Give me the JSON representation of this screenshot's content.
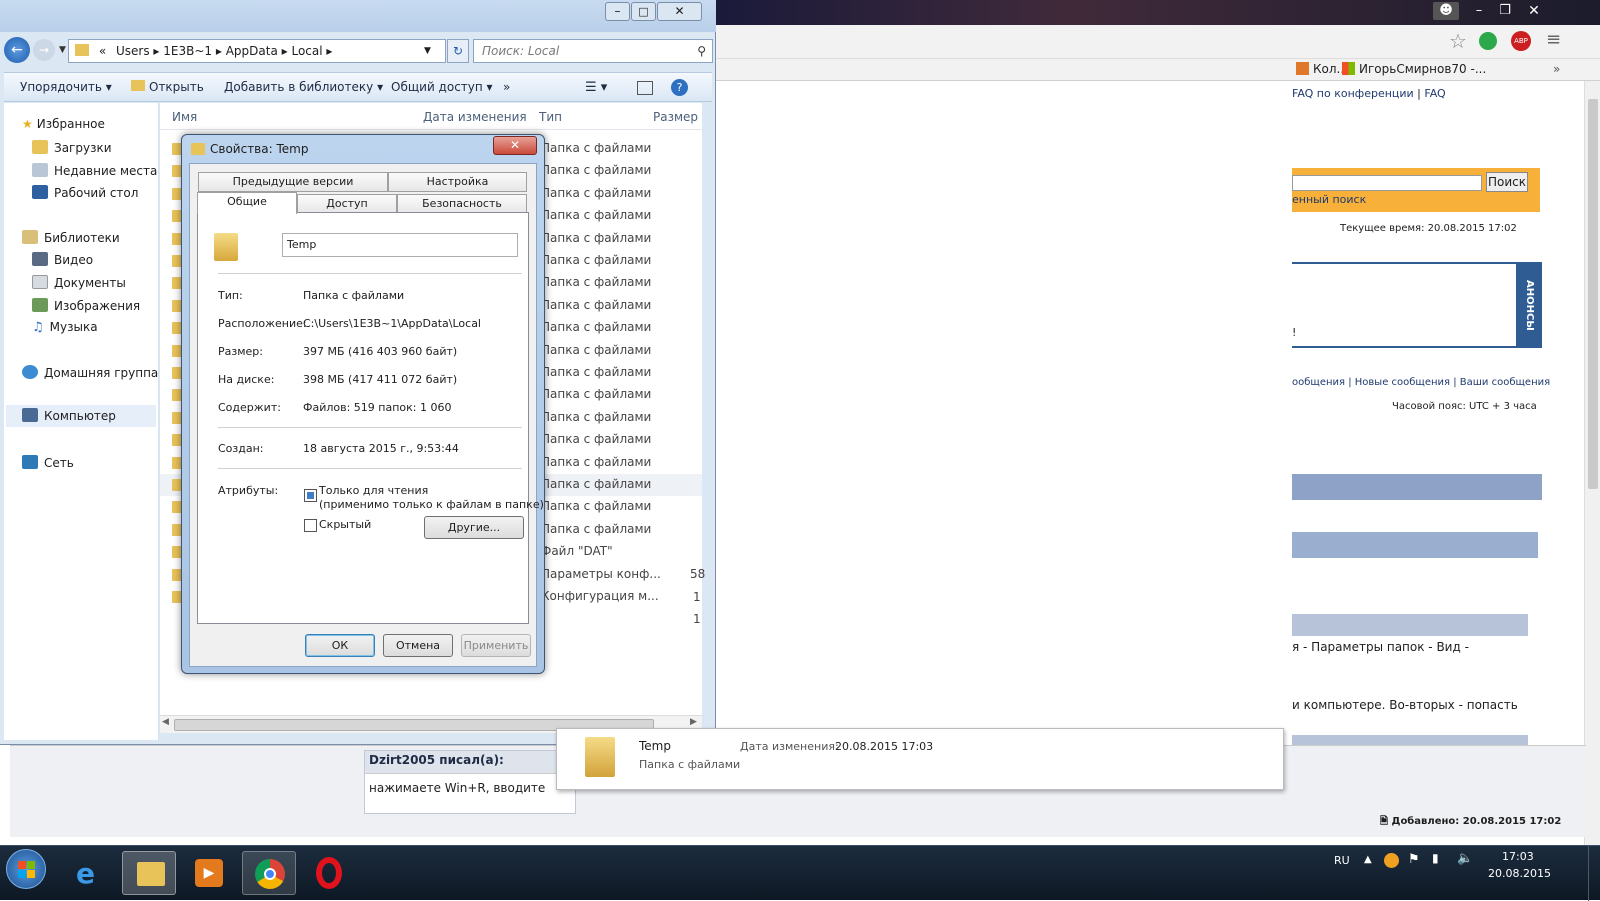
{
  "chrome": {
    "bookmarks": [
      "Кол...",
      "ИгорьСмирнов70 -..."
    ],
    "faq_links": [
      "FAQ по конференции",
      "FAQ"
    ],
    "search_btn": "Поиск",
    "advanced_search": "енный поиск",
    "current_time": "Текущее время: 20.08.2015 17:02",
    "announce": "АНОНСЫ",
    "announce_tail": "!",
    "links_row": [
      "ообщения",
      "Новые сообщения",
      "Ваши сообщения"
    ],
    "timezone": "Часовой пояс: UTC + 3 часа",
    "body_text1": "я - Параметры папок - Вид -",
    "body_text2": "и компьютере. Во-вторых - попасть",
    "quote_author": "Dzirt2005 писал(а):",
    "quote_text": "нажимаете Win+R, вводите",
    "added": "Добавлено: 20.08.2015 17:02"
  },
  "explorer": {
    "breadcrumb": [
      "«",
      "Users",
      "1E3B~1",
      "AppData",
      "Local"
    ],
    "search_placeholder": "Поиск: Local",
    "commands": [
      "Упорядочить",
      "Открыть",
      "Добавить в библиотеку",
      "Общий доступ",
      "»"
    ],
    "nav": {
      "favorites": "Избранное",
      "fav_items": [
        "Загрузки",
        "Недавние места",
        "Рабочий стол"
      ],
      "libraries": "Библиотеки",
      "lib_items": [
        "Видео",
        "Документы",
        "Изображения",
        "Музыка"
      ],
      "homegroup": "Домашняя группа",
      "computer": "Компьютер",
      "network": "Сеть"
    },
    "columns": {
      "name": "Имя",
      "date": "Дата изменения",
      "type": "Тип",
      "size": "Размер"
    },
    "types": [
      "Папка с файлами",
      "Папка с файлами",
      "Папка с файлами",
      "Папка с файлами",
      "Папка с файлами",
      "Папка с файлами",
      "Папка с файлами",
      "Папка с файлами",
      "Папка с файлами",
      "Папка с файлами",
      "Папка с файлами",
      "Папка с файлами",
      "Папка с файлами",
      "Папка с файлами",
      "Папка с файлами",
      "Папка с файлами",
      "Папка с файлами",
      "Папка с файлами",
      "Файл \"DAT\"",
      "Параметры конф...",
      "Конфигурация м..."
    ],
    "sizes": [
      "58",
      "1",
      "1"
    ]
  },
  "dialog": {
    "title": "Свойства: Temp",
    "tabs_top": [
      "Предыдущие версии",
      "Настройка"
    ],
    "tabs_bottom": [
      "Общие",
      "Доступ",
      "Безопасность"
    ],
    "name": "Temp",
    "rows": [
      {
        "label": "Тип:",
        "value": "Папка с файлами"
      },
      {
        "label": "Расположение:",
        "value": "C:\\Users\\1E3B~1\\AppData\\Local"
      },
      {
        "label": "Размер:",
        "value": "397 МБ (416 403 960 байт)"
      },
      {
        "label": "На диске:",
        "value": "398 МБ (417 411 072 байт)"
      },
      {
        "label": "Содержит:",
        "value": "Файлов: 519 папок: 1 060"
      }
    ],
    "created_label": "Создан:",
    "created_value": "18 августа 2015 г., 9:53:44",
    "attributes_label": "Атрибуты:",
    "readonly_label": "Только для чтения",
    "readonly_note": "(применимо только к файлам в папке)",
    "hidden_label": "Скрытый",
    "other_btn": "Другие...",
    "ok": "ОК",
    "cancel": "Отмена",
    "apply": "Применить"
  },
  "tooltip": {
    "name": "Temp",
    "date_label": "Дата изменения:",
    "date_value": "20.08.2015 17:03",
    "type": "Папка с файлами"
  },
  "taskbar": {
    "lang": "RU",
    "time": "17:03",
    "date": "20.08.2015"
  }
}
